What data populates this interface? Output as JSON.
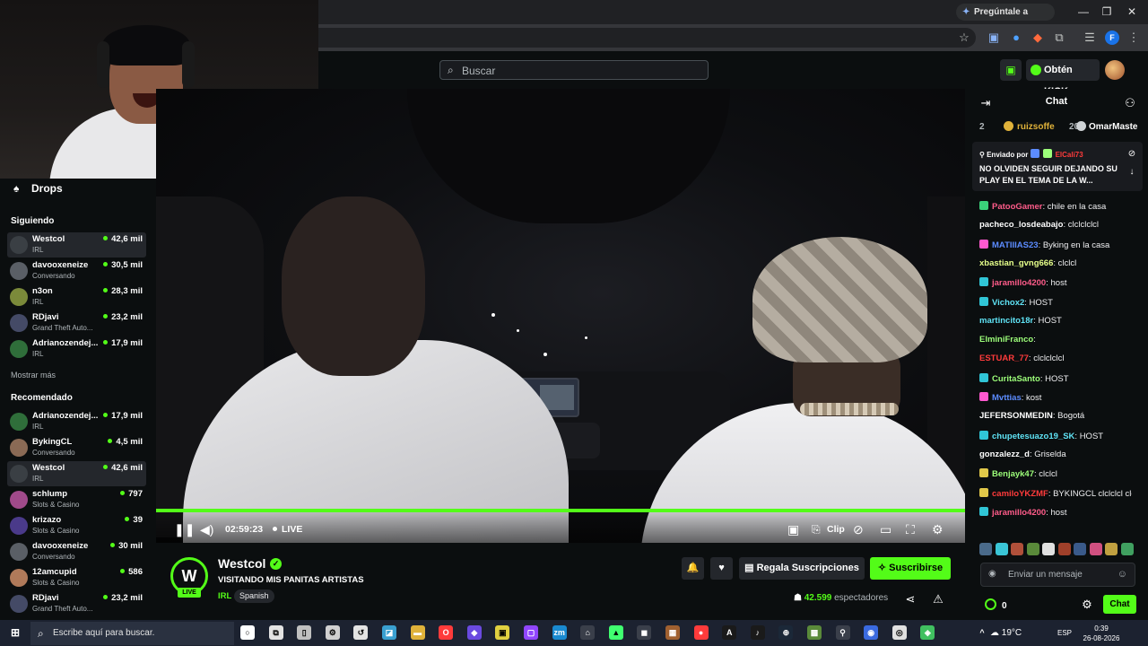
{
  "browser": {
    "gemini_label": "Pregúntale a Gemini",
    "profile_initial": "F"
  },
  "header": {
    "search_placeholder": "Buscar",
    "kicks_label": "Obtén KICKs"
  },
  "sidebar": {
    "drops_label": "Drops",
    "following_title": "Siguiendo",
    "show_more": "Mostrar más",
    "recommended_title": "Recomendado",
    "following": [
      {
        "name": "Westcol",
        "category": "IRL",
        "viewers": "42,6 mil",
        "avatar_color": "#3a3f44",
        "active": true
      },
      {
        "name": "davooxeneize",
        "category": "Conversando",
        "viewers": "30,5 mil",
        "avatar_color": "#5a5f66",
        "active": false
      },
      {
        "name": "n3on",
        "category": "IRL",
        "viewers": "28,3 mil",
        "avatar_color": "#7b8a3a",
        "active": false
      },
      {
        "name": "RDjavi",
        "category": "Grand Theft Auto...",
        "viewers": "23,2 mil",
        "avatar_color": "#444a66",
        "active": false
      },
      {
        "name": "Adrianozendej...",
        "category": "IRL",
        "viewers": "17,9 mil",
        "avatar_color": "#2f6e3a",
        "active": false
      }
    ],
    "recommended": [
      {
        "name": "Adrianozendej...",
        "category": "IRL",
        "viewers": "17,9 mil",
        "avatar_color": "#2f6e3a",
        "active": false
      },
      {
        "name": "BykingCL",
        "category": "Conversando",
        "viewers": "4,5 mil",
        "avatar_color": "#8a6a55",
        "active": false
      },
      {
        "name": "Westcol",
        "category": "IRL",
        "viewers": "42,6 mil",
        "avatar_color": "#3a3f44",
        "active": true
      },
      {
        "name": "schlump",
        "category": "Slots & Casino",
        "viewers": "797",
        "avatar_color": "#a04a8a",
        "active": false
      },
      {
        "name": "krizazo",
        "category": "Slots & Casino",
        "viewers": "39",
        "avatar_color": "#4a3a8a",
        "active": false
      },
      {
        "name": "davooxeneize",
        "category": "Conversando",
        "viewers": "30 mil",
        "avatar_color": "#5a5f66",
        "active": false
      },
      {
        "name": "12amcupid",
        "category": "Slots & Casino",
        "viewers": "586",
        "avatar_color": "#b07a5a",
        "active": false
      },
      {
        "name": "RDjavi",
        "category": "Grand Theft Auto...",
        "viewers": "23,2 mil",
        "avatar_color": "#444a66",
        "active": false
      }
    ]
  },
  "player": {
    "time": "02:59:23",
    "live_label": "LIVE",
    "clip_label": "Clip",
    "progress": 1.0
  },
  "stream": {
    "channel": "Westcol",
    "live_badge": "LIVE",
    "title": "VISITANDO MIS PANITAS ARTISTAS",
    "category": "IRL",
    "tag": "Spanish",
    "gift_label": "Regala Suscripciones",
    "subscribe_label": "Suscribirse",
    "viewers_count": "42.599",
    "viewers_label": "espectadores"
  },
  "chat": {
    "title": "Chat",
    "top_gifters": {
      "rank": "2",
      "user1": "ruizsoffe",
      "count1": "20",
      "user2": "OmarMaste"
    },
    "pinned": {
      "sent_by_label": "Enviado por",
      "sender": "ElCali73",
      "text": "NO OLVIDEN SEGUIR DEJANDO SU PLAY EN EL TEMA DE LA W..."
    },
    "messages": [
      {
        "user": "PatooGamer",
        "color": "#ff5c8a",
        "text": "chile en la casa",
        "badge": "#3ad27a"
      },
      {
        "user": "pacheco_losdeabajo",
        "color": "#ffffff",
        "text": "clclclclcl",
        "badge": ""
      },
      {
        "user": "MATIIIAS23",
        "color": "#5c8cff",
        "text": "Byking en la casa",
        "badge": "#ff59d0"
      },
      {
        "user": "xbastian_gvng666",
        "color": "#e6ff8a",
        "text": "clclcl",
        "badge": ""
      },
      {
        "user": "jaramillo4200",
        "color": "#ff5c8a",
        "text": "host",
        "badge": "#30c5d6"
      },
      {
        "user": "Vichox2",
        "color": "#5fe3f5",
        "text": "HOST",
        "badge": "#30c5d6"
      },
      {
        "user": "martincito18r",
        "color": "#5fe3f5",
        "text": "HOST",
        "badge": ""
      },
      {
        "user": "ElminiFranco",
        "color": "#9dff7a",
        "text": "",
        "badge": ""
      },
      {
        "user": "ESTUAR_77",
        "color": "#ff3b3b",
        "text": "clclclclcl",
        "badge": ""
      },
      {
        "user": "CuritaSanto",
        "color": "#9dff7a",
        "text": "HOST",
        "badge": "#30c5d6"
      },
      {
        "user": "Mvttias",
        "color": "#5c8cff",
        "text": "kost",
        "badge": "#ff59d0"
      },
      {
        "user": "JEFERSONMEDIN",
        "color": "#ffffff",
        "text": "Bogotá",
        "badge": ""
      },
      {
        "user": "chupetesuazo19_SK",
        "color": "#5fe3f5",
        "text": "HOST",
        "badge": "#30c5d6"
      },
      {
        "user": "gonzalezz_d",
        "color": "#ffffff",
        "text": "Griselda",
        "badge": ""
      },
      {
        "user": "Benjayk47",
        "color": "#9dff7a",
        "text": "clclcl",
        "badge": "#e0c84a"
      },
      {
        "user": "camiloYKZMF",
        "color": "#ff3b3b",
        "text": "BYKINGCL clclclcl clcl",
        "badge": "#e0c84a"
      },
      {
        "user": "jaramillo4200",
        "color": "#ff5c8a",
        "text": "host",
        "badge": "#30c5d6"
      }
    ],
    "input_placeholder": "Enviar un mensaje",
    "kicks_count": "0",
    "send_label": "Chat"
  },
  "taskbar": {
    "search_placeholder": "Escribe aquí para buscar.",
    "weather": "19°C",
    "language": "ESP",
    "time": "0:39",
    "date": "26-08-2026"
  }
}
